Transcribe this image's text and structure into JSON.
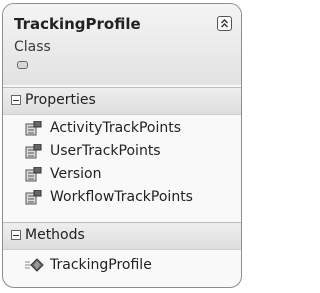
{
  "class_shape": {
    "name": "TrackingProfile",
    "kind": "Class"
  },
  "sections": {
    "properties": {
      "label": "Properties",
      "items": [
        "ActivityTrackPoints",
        "UserTrackPoints",
        "Version",
        "WorkflowTrackPoints"
      ]
    },
    "methods": {
      "label": "Methods",
      "items": [
        "TrackingProfile"
      ]
    }
  },
  "icons": {
    "collapse": "double-chevron-up-icon",
    "expander": "pill-icon",
    "property": "property-icon",
    "method": "method-icon"
  }
}
